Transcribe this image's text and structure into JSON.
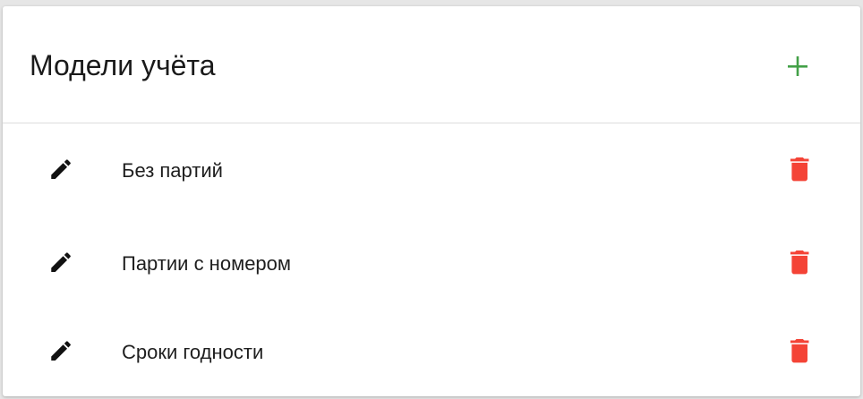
{
  "header": {
    "title": "Модели учёта",
    "add_icon": "plus-icon"
  },
  "items": [
    {
      "label": "Без партий",
      "edit_icon": "pencil-icon",
      "delete_icon": "trash-icon"
    },
    {
      "label": "Партии с номером",
      "edit_icon": "pencil-icon",
      "delete_icon": "trash-icon"
    },
    {
      "label": "Сроки годности",
      "edit_icon": "pencil-icon",
      "delete_icon": "trash-icon"
    }
  ],
  "colors": {
    "add": "#43a047",
    "delete": "#f44336",
    "edit": "#111111"
  }
}
